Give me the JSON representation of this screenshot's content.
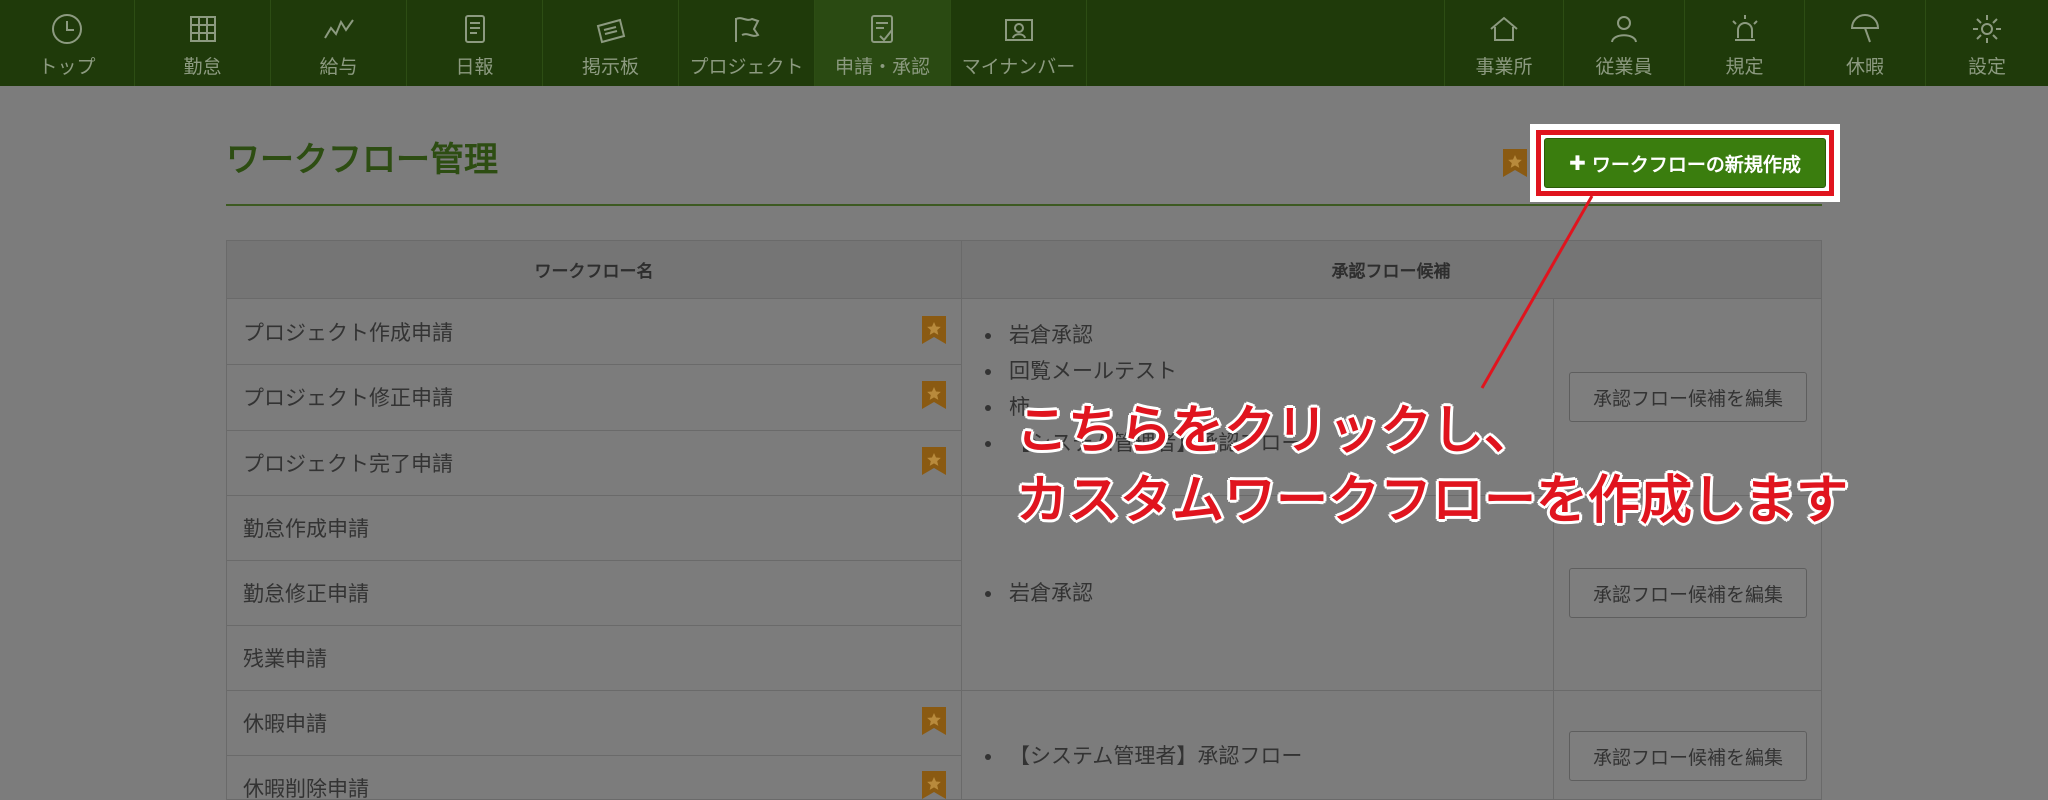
{
  "nav_left": [
    {
      "label": "トップ",
      "icon": "clock-icon"
    },
    {
      "label": "勤怠",
      "icon": "calendar-grid-icon"
    },
    {
      "label": "給与",
      "icon": "chart-line-icon"
    },
    {
      "label": "日報",
      "icon": "notebook-icon"
    },
    {
      "label": "掲示板",
      "icon": "board-icon"
    },
    {
      "label": "プロジェクト",
      "icon": "flag-icon"
    },
    {
      "label": "申請・承認",
      "icon": "clipboard-check-icon"
    },
    {
      "label": "マイナンバー",
      "icon": "id-card-icon"
    }
  ],
  "nav_right": [
    {
      "label": "事業所",
      "icon": "house-icon"
    },
    {
      "label": "従業員",
      "icon": "person-icon"
    },
    {
      "label": "規定",
      "icon": "alarm-light-icon"
    },
    {
      "label": "休暇",
      "icon": "beach-umbrella-icon"
    },
    {
      "label": "設定",
      "icon": "gear-icon"
    }
  ],
  "page": {
    "title": "ワークフロー管理",
    "create_button": "ワークフローの新規作成"
  },
  "table": {
    "col_name": "ワークフロー名",
    "col_flow": "承認フロー候補",
    "edit_label": "承認フロー候補を編集",
    "rows": [
      {
        "name": "プロジェクト作成申請",
        "favorite": true
      },
      {
        "name": "プロジェクト修正申請",
        "favorite": true
      },
      {
        "name": "プロジェクト完了申請",
        "favorite": true
      },
      {
        "name": "勤怠作成申請",
        "favorite": false
      },
      {
        "name": "勤怠修正申請",
        "favorite": false
      },
      {
        "name": "残業申請",
        "favorite": false
      },
      {
        "name": "休暇申請",
        "favorite": true
      },
      {
        "name": "休暇削除申請",
        "favorite": true
      }
    ],
    "groups": [
      {
        "flows": [
          "岩倉承認",
          "回覧メールテスト",
          "柿",
          "【システム管理者】承認フロー"
        ]
      },
      {
        "flows": [
          "岩倉承認"
        ]
      },
      {
        "flows": [
          "【システム管理者】承認フロー"
        ]
      }
    ]
  },
  "annotation": {
    "line1": "こちらをクリックし、",
    "line2": "カスタムワークフローを作成します"
  }
}
